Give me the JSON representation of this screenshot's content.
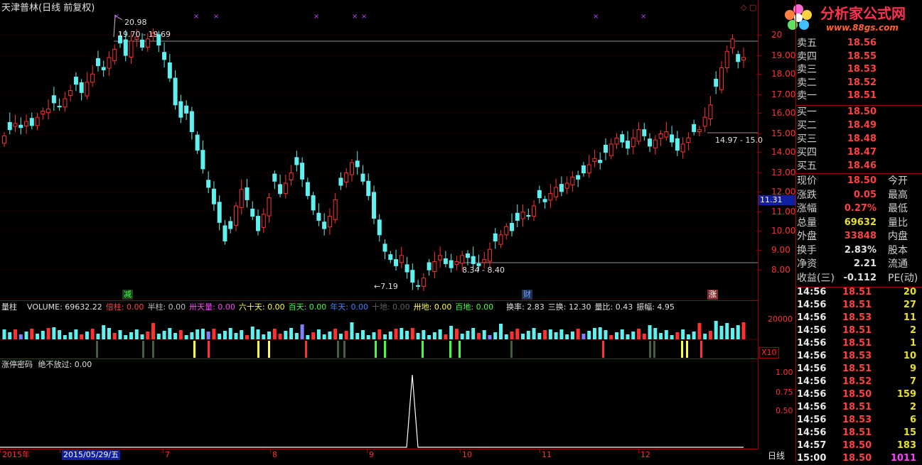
{
  "chart_title": "天津普林(日线 前复权)",
  "logo": {
    "text": "分析家公式网",
    "url": "www.88gs.com"
  },
  "price_axis": {
    "ticks": [
      "20",
      "19.00",
      "18.00",
      "17.00",
      "16.00",
      "15.00",
      "14.00",
      "13.00",
      "12.00",
      "11.00",
      "10.00",
      "9.00",
      "8.00"
    ],
    "cursor_value": "11.31"
  },
  "annotations": {
    "high_label": "20.98",
    "high_range": "19.70 - 19.69",
    "right_range": "14.97 - 15.0",
    "low_range": "8.34 - 8.40",
    "low_label": "7.19",
    "marker_reduce": "减",
    "marker_finance": "财",
    "marker_rise": "涨"
  },
  "volume_panel": {
    "title": "量柱",
    "items": [
      {
        "label": "VOLUME: 69632.22",
        "color": "#e0e0e0"
      },
      {
        "label": "倍柱: 0.00",
        "color": "#ff4040"
      },
      {
        "label": "半柱: 0.00",
        "color": "#c0c0c0"
      },
      {
        "label": "卅天量: 0.00",
        "color": "#ff40ff"
      },
      {
        "label": "六十天: 0.00",
        "color": "#ffff40"
      },
      {
        "label": "百天: 0.00",
        "color": "#40ff40"
      },
      {
        "label": "年天: 0.00",
        "color": "#4080ff"
      },
      {
        "label": "十地: 0.00",
        "color": "#606060"
      },
      {
        "label": "卅地: 0.00",
        "color": "#ffff40"
      },
      {
        "label": "百地: 0.00",
        "color": "#40ff40"
      },
      {
        "label": "换率: 2.83",
        "color": "#e0e0e0"
      },
      {
        "label": "三换: 12.30",
        "color": "#e0e0e0"
      },
      {
        "label": "量比: 0.43",
        "color": "#e0e0e0"
      },
      {
        "label": "振幅: 4.95",
        "color": "#e0e0e0"
      }
    ],
    "axis_tick": "20000",
    "scale_label": "X10"
  },
  "indicator_panel": {
    "title": "涨停密码",
    "value_label": "绝不放过: 0.00",
    "ticks": [
      "1.00",
      "0.75",
      "0.50"
    ]
  },
  "time_axis": {
    "labels": [
      "2015年",
      "2015/05/29/五",
      "7",
      "8",
      "9",
      "10",
      "11",
      "12"
    ],
    "period": "日线"
  },
  "quote": {
    "sell": [
      {
        "label": "卖五",
        "price": "18.56"
      },
      {
        "label": "卖四",
        "price": "18.55"
      },
      {
        "label": "卖三",
        "price": "18.53"
      },
      {
        "label": "卖二",
        "price": "18.52"
      },
      {
        "label": "卖一",
        "price": "18.51"
      }
    ],
    "buy": [
      {
        "label": "买一",
        "price": "18.50"
      },
      {
        "label": "买二",
        "price": "18.49"
      },
      {
        "label": "买三",
        "price": "18.48"
      },
      {
        "label": "买四",
        "price": "18.47"
      },
      {
        "label": "买五",
        "price": "18.46"
      }
    ],
    "stats": [
      {
        "label": "现价",
        "value": "18.50",
        "label2": "今开",
        "color": "#ff4040"
      },
      {
        "label": "涨跌",
        "value": "0.05",
        "label2": "最高",
        "color": "#ff4040"
      },
      {
        "label": "涨幅",
        "value": "0.27%",
        "label2": "最低",
        "color": "#ff4040"
      },
      {
        "label": "总量",
        "value": "69632",
        "label2": "量比",
        "color": "#e8e020"
      },
      {
        "label": "外盘",
        "value": "33848",
        "label2": "内盘",
        "color": "#ff4040"
      },
      {
        "label": "换手",
        "value": "2.83%",
        "label2": "股本",
        "color": "#e0e0e0"
      },
      {
        "label": "净资",
        "value": "2.21",
        "label2": "流通",
        "color": "#e0e0e0"
      },
      {
        "label": "收益(三)",
        "value": "-0.112",
        "label2": "PE(动)",
        "color": "#e0e0e0"
      }
    ],
    "ticks": [
      {
        "time": "14:56",
        "price": "18.51",
        "vol": "20"
      },
      {
        "time": "14:56",
        "price": "18.51",
        "vol": "27"
      },
      {
        "time": "14:56",
        "price": "18.53",
        "vol": "11"
      },
      {
        "time": "14:56",
        "price": "18.51",
        "vol": "2"
      },
      {
        "time": "14:56",
        "price": "18.51",
        "vol": "1"
      },
      {
        "time": "14:56",
        "price": "18.53",
        "vol": "10"
      },
      {
        "time": "14:56",
        "price": "18.51",
        "vol": "9"
      },
      {
        "time": "14:56",
        "price": "18.52",
        "vol": "7"
      },
      {
        "time": "14:56",
        "price": "18.50",
        "vol": "159"
      },
      {
        "time": "14:56",
        "price": "18.51",
        "vol": "2"
      },
      {
        "time": "14:56",
        "price": "18.53",
        "vol": "6"
      },
      {
        "time": "14:56",
        "price": "18.51",
        "vol": "15"
      },
      {
        "time": "14:57",
        "price": "18.50",
        "vol": "183"
      },
      {
        "time": "15:00",
        "price": "18.50",
        "vol": "1011"
      }
    ]
  },
  "chart_data": {
    "type": "candlestick",
    "ylim": [
      7.0,
      20.6
    ],
    "closes": [
      14.7,
      15.0,
      15.3,
      15.1,
      15.4,
      15.2,
      15.6,
      15.9,
      16.0,
      16.3,
      16.1,
      16.5,
      16.9,
      17.2,
      16.8,
      17.3,
      17.7,
      18.1,
      17.9,
      18.5,
      18.9,
      19.2,
      18.6,
      19.3,
      19.5,
      19.0,
      19.4,
      19.69,
      19.1,
      18.4,
      17.5,
      16.2,
      15.6,
      15.8,
      14.9,
      14.0,
      13.1,
      12.2,
      11.4,
      10.5,
      9.6,
      10.2,
      11.3,
      12.1,
      11.6,
      10.8,
      10.1,
      10.9,
      11.7,
      12.5,
      11.9,
      12.4,
      12.9,
      13.3,
      12.6,
      11.8,
      11.1,
      10.6,
      10.2,
      10.8,
      11.6,
      12.3,
      12.9,
      13.4,
      13.2,
      12.5,
      11.8,
      10.7,
      9.9,
      9.1,
      8.7,
      8.4,
      8.9,
      8.1,
      7.6,
      7.4,
      7.8,
      8.2,
      8.6,
      8.9,
      8.5,
      8.3,
      8.6,
      8.9,
      8.8,
      8.5,
      8.4,
      8.7,
      9.2,
      9.6,
      9.9,
      10.3,
      10.1,
      10.6,
      11.0,
      10.8,
      11.3,
      11.7,
      11.5,
      11.9,
      12.2,
      12.0,
      12.4,
      12.7,
      12.6,
      12.9,
      13.3,
      13.6,
      13.4,
      13.9,
      14.3,
      14.6,
      14.4,
      14.1,
      14.6,
      15.0,
      14.7,
      14.2,
      14.5,
      14.8,
      14.9,
      14.4,
      14.0,
      14.3,
      14.6,
      14.9,
      15.0,
      15.6,
      16.2,
      17.1,
      18.0,
      18.8,
      19.4,
      18.3,
      18.5
    ],
    "volume_ticks": [
      "20000"
    ]
  }
}
